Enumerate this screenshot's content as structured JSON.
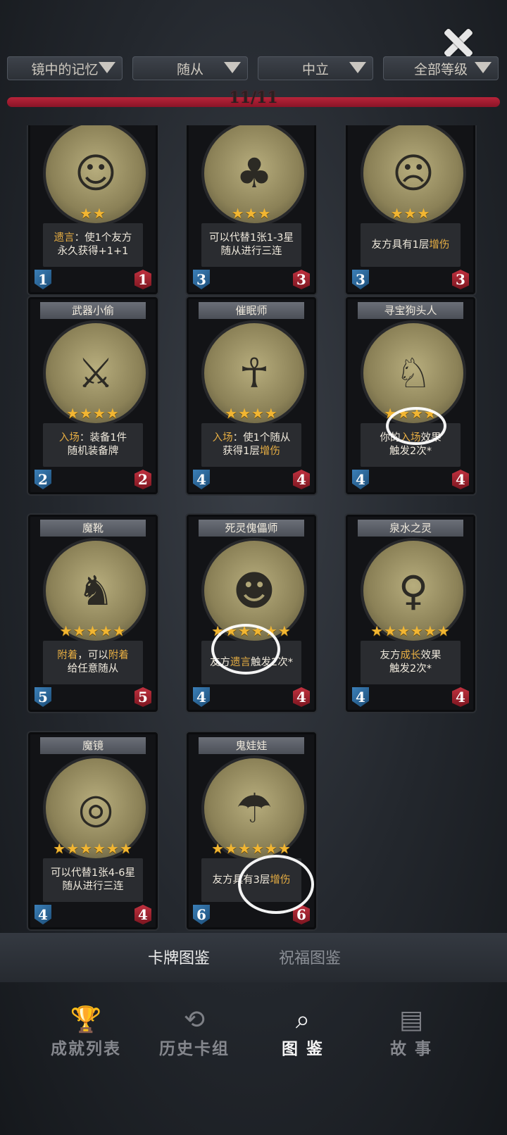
{
  "header": {
    "close_icon": "close-icon",
    "filters": [
      {
        "label": "镜中的记忆"
      },
      {
        "label": "随从"
      },
      {
        "label": "中立"
      },
      {
        "label": "全部等级"
      }
    ],
    "progress_text": "11/11",
    "progress_fraction": 1.0
  },
  "cards": [
    {
      "name": "",
      "stars": 2,
      "desc_lines": [
        [
          {
            "t": "遗言",
            "k": true
          },
          {
            "t": "：使1个友方"
          }
        ],
        [
          {
            "t": "永久获得+1+1"
          }
        ]
      ],
      "attack": "1",
      "health": "1",
      "icon": "old-man-portrait"
    },
    {
      "name": "",
      "stars": 3,
      "desc_lines": [
        [
          {
            "t": "可以代替1张1-3星"
          }
        ],
        [
          {
            "t": "随从进行三连"
          }
        ]
      ],
      "attack": "3",
      "health": "3",
      "icon": "frog-portrait"
    },
    {
      "name": "",
      "stars": 3,
      "desc_lines": [
        [
          {
            "t": "友方具有1层"
          },
          {
            "t": "增伤",
            "k": true
          }
        ]
      ],
      "attack": "3",
      "health": "3",
      "icon": "doll-portrait"
    },
    {
      "name": "武器小偷",
      "stars": 4,
      "desc_lines": [
        [
          {
            "t": "入场",
            "k": true
          },
          {
            "t": "：装备1件"
          }
        ],
        [
          {
            "t": "随机装备牌"
          }
        ]
      ],
      "attack": "2",
      "health": "2",
      "icon": "thief-portrait"
    },
    {
      "name": "催眠师",
      "stars": 4,
      "desc_lines": [
        [
          {
            "t": "入场",
            "k": true
          },
          {
            "t": "：使1个随从"
          }
        ],
        [
          {
            "t": "获得1层"
          },
          {
            "t": "增伤",
            "k": true
          }
        ]
      ],
      "attack": "4",
      "health": "4",
      "icon": "witch-portrait"
    },
    {
      "name": "寻宝狗头人",
      "stars": 4,
      "desc_lines": [
        [
          {
            "t": "你的"
          },
          {
            "t": "入场",
            "k": true
          },
          {
            "t": "效果"
          }
        ],
        [
          {
            "t": "触发2次*"
          }
        ]
      ],
      "attack": "4",
      "health": "4",
      "icon": "kobold-portrait"
    },
    {
      "name": "魔靴",
      "stars": 5,
      "desc_lines": [
        [
          {
            "t": "附着",
            "k": true
          },
          {
            "t": "，可以"
          },
          {
            "t": "附着",
            "k": true
          }
        ],
        [
          {
            "t": "给任意随从"
          }
        ]
      ],
      "attack": "5",
      "health": "5",
      "icon": "boots-portrait"
    },
    {
      "name": "死灵傀儡师",
      "stars": 6,
      "desc_lines": [
        [
          {
            "t": "友方"
          },
          {
            "t": "遗言",
            "k": true
          },
          {
            "t": "触发2次*"
          }
        ]
      ],
      "attack": "4",
      "health": "4",
      "icon": "clown-portrait"
    },
    {
      "name": "泉水之灵",
      "stars": 6,
      "desc_lines": [
        [
          {
            "t": "友方"
          },
          {
            "t": "成长",
            "k": true
          },
          {
            "t": "效果"
          }
        ],
        [
          {
            "t": "触发2次*"
          }
        ]
      ],
      "attack": "4",
      "health": "4",
      "icon": "spirit-portrait"
    },
    {
      "name": "魔镜",
      "stars": 6,
      "desc_lines": [
        [
          {
            "t": "可以代替1张4-6星"
          }
        ],
        [
          {
            "t": "随从进行三连"
          }
        ]
      ],
      "attack": "4",
      "health": "4",
      "icon": "mirror-portrait"
    },
    {
      "name": "鬼娃娃",
      "stars": 6,
      "desc_lines": [
        [
          {
            "t": "友方具有3层"
          },
          {
            "t": "增伤",
            "k": true
          }
        ]
      ],
      "attack": "6",
      "health": "6",
      "icon": "scarecrow-portrait"
    }
  ],
  "bottom_tabs": {
    "active": "卡牌图鉴",
    "inactive": "祝福图鉴"
  },
  "nav": [
    {
      "label": "成就列表",
      "icon": "trophy-icon",
      "active": false
    },
    {
      "label": "历史卡组",
      "icon": "history-icon",
      "active": false
    },
    {
      "label": "图 鉴",
      "icon": "magnifier-icon",
      "active": true
    },
    {
      "label": "故 事",
      "icon": "book-icon",
      "active": false
    }
  ]
}
